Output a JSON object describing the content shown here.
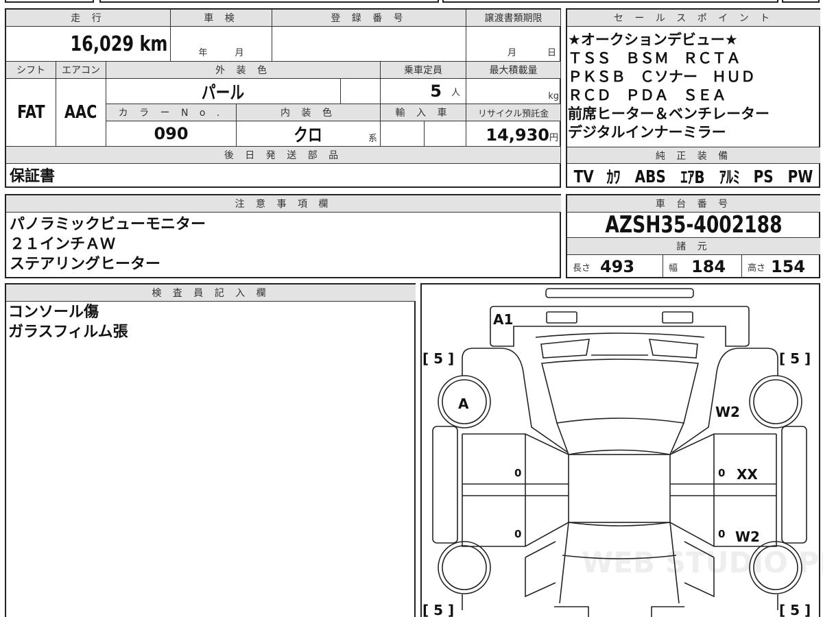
{
  "vehicle_info": {
    "headers": {
      "mileage": "走 行",
      "inspection": "車 検",
      "registration": "登 録 番 号",
      "transfer_deadline": "譲渡書類期限",
      "shift": "シフト",
      "aircon": "エアコン",
      "exterior_color": "外 装 色",
      "capacity": "乗車定員",
      "max_load": "最大積載量",
      "color_no": "カ ラ ー N o .",
      "interior_color": "内 装 色",
      "import": "輸 入 車",
      "recycle_fee": "リサイクル預託金",
      "later_parts": "後 日 発 送 部 品"
    },
    "mileage": "16,029 km",
    "inspection_year_unit": "年",
    "inspection_month_unit": "月",
    "deadline_month_unit": "月",
    "deadline_day_unit": "日",
    "shift": "FAT",
    "aircon": "AAC",
    "exterior_color": "パール",
    "capacity": "5",
    "capacity_unit": "人",
    "max_load_unit": "kg",
    "color_no": "090",
    "interior_color": "クロ",
    "interior_suffix": "系",
    "recycle_fee": "14,930",
    "recycle_unit": "円",
    "later_parts": "保証書"
  },
  "notes": {
    "header": "注 意 事 項 欄",
    "lines": [
      "パノラミックビューモニター",
      "２１インチＡＷ",
      "ステアリングヒーター"
    ]
  },
  "sales_points": {
    "header": "セ ー ル ス ポ イ ン ト",
    "lines": [
      "★オークションデビュー★",
      "ＴＳＳ　ＢＳＭ　ＲＣＴＡ",
      "ＰＫＳＢ　Ｃソナー　ＨＵＤ",
      "ＲＣＤ　ＰＤＡ　ＳＥＡ",
      "前席ヒーター＆ベンチレーター",
      "デジタルインナーミラー"
    ]
  },
  "equipment": {
    "header": "純 正 装 備",
    "items": [
      "TV",
      "ｶﾜ",
      "ABS",
      "ｴｱB",
      "ｱﾙﾐ",
      "PS",
      "PW"
    ]
  },
  "chassis": {
    "header": "車 台 番 号",
    "number": "AZSH35-4002188",
    "spec_header": "諸 元",
    "length_label": "長さ",
    "length": "493",
    "width_label": "幅",
    "width": "184",
    "height_label": "高さ",
    "height": "154"
  },
  "inspector": {
    "header": "検 査 員 記 入 欄",
    "lines": [
      "コンソール傷",
      "ガラスフィルム張"
    ]
  },
  "diagram": {
    "marks": {
      "front_bumper": "A1",
      "front_left_wheel": "A",
      "front_right_fender": "W2",
      "right_front_door": "XX",
      "right_rear_door": "W2",
      "door_left_front": "0",
      "door_left_rear": "0",
      "door_right_front": "0",
      "door_right_rear": "0"
    },
    "tire_tread": [
      "[ 5 ]",
      "[ 5 ]",
      "[ 5 ]",
      "[ 5 ]"
    ],
    "watermark": "WEB STUDIO PRO"
  }
}
